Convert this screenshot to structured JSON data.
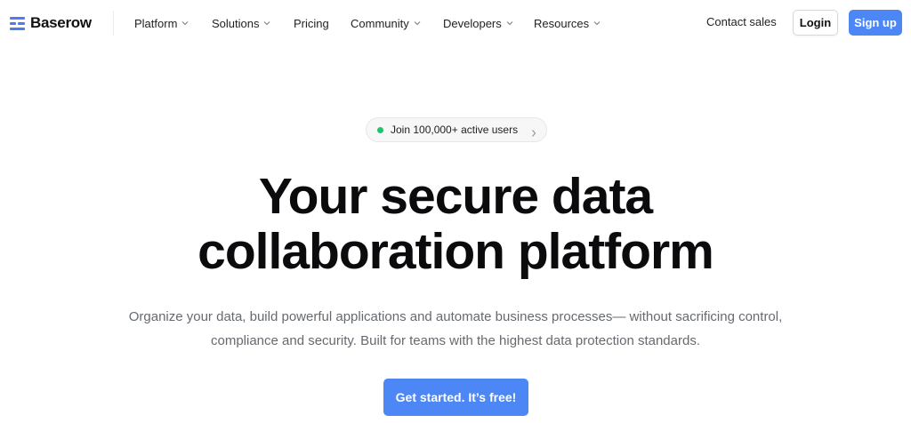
{
  "brand": {
    "name": "Baserow",
    "accent": "#4d86f5"
  },
  "nav": {
    "menu": [
      {
        "label": "Platform",
        "has_dropdown": true
      },
      {
        "label": "Solutions",
        "has_dropdown": true
      },
      {
        "label": "Pricing",
        "has_dropdown": false
      },
      {
        "label": "Community",
        "has_dropdown": true
      },
      {
        "label": "Developers",
        "has_dropdown": true
      },
      {
        "label": "Resources",
        "has_dropdown": true
      }
    ],
    "contact_label": "Contact sales",
    "login_label": "Login",
    "signup_label": "Sign up"
  },
  "hero": {
    "badge": {
      "text": "Join 100,000+ active users",
      "status_color": "#21c36b"
    },
    "headline": {
      "line1": "Your secure data",
      "line2": "collaboration platform"
    },
    "subtitle": {
      "line1": "Organize your data, build powerful applications and automate business processes— without sacrificing control,",
      "line2": "compliance and security. Built for teams with the highest data protection standards."
    },
    "cta_label": "Get started. It’s free!"
  }
}
